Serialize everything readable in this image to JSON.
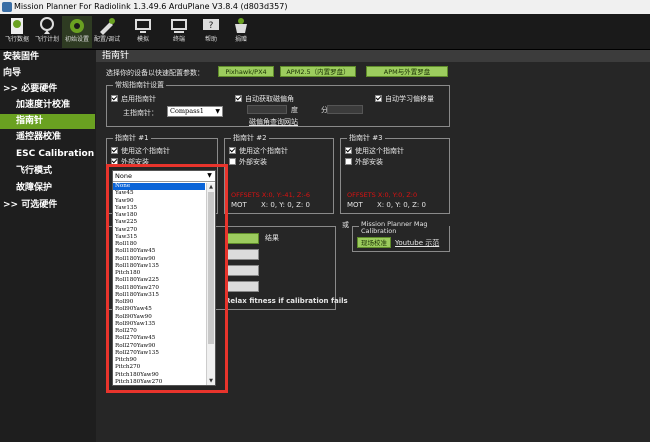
{
  "window": {
    "title": "Mission Planner For Radiolink 1.3.49.6 ArduPlane V3.8.4 (d803d357)"
  },
  "toolbar": {
    "buttons": [
      {
        "label": "飞行数据",
        "icon": "flight-data-icon"
      },
      {
        "label": "飞行计划",
        "icon": "flight-plan-icon"
      },
      {
        "label": "初始设置",
        "icon": "initial-setup-icon"
      },
      {
        "label": "配置/调试",
        "icon": "config-tuning-icon"
      },
      {
        "label": "模拟",
        "icon": "simulation-icon"
      },
      {
        "label": "终端",
        "icon": "terminal-icon"
      },
      {
        "label": "帮助",
        "icon": "help-icon"
      },
      {
        "label": "捐赠",
        "icon": "donate-icon"
      }
    ]
  },
  "sidebar": {
    "items": [
      {
        "label": "安装固件"
      },
      {
        "label": "向导"
      },
      {
        "label": ">> 必要硬件"
      },
      {
        "label": "加速度计校准"
      },
      {
        "label": "指南针"
      },
      {
        "label": "遥控器校准"
      },
      {
        "label": "ESC Calibration"
      },
      {
        "label": "飞行模式"
      },
      {
        "label": "故障保护"
      },
      {
        "label": ">> 可选硬件"
      }
    ],
    "active_index": 4
  },
  "main": {
    "header": "指南针",
    "preset_label": "选择你的设备以快速配置参数：",
    "preset_buttons": [
      "Pixhawk/PX4",
      "APM2.5（内置罗盘）",
      "APM与外置罗盘"
    ],
    "general": {
      "title": "常规指南针设置",
      "enable_compass": "启用指南针",
      "primary_compass_label": "主指南针：",
      "primary_compass_value": "Compass1",
      "auto_declination": "自动获取磁偏角",
      "degree_label": "度",
      "minute_label": "分",
      "auto_learn": "自动学习偏移量",
      "declination_link": "磁偏角查询网站"
    },
    "compass1": {
      "title": "指南针 #1",
      "use": "使用这个指南针",
      "external": "外部安装"
    },
    "compass2": {
      "title": "指南针 #2",
      "use": "使用这个指南针",
      "external": "外部安装",
      "offsets": "OFFSETS X:0, Y:-41, Z:-6",
      "mot": "MOT",
      "mot_values": "X: 0,  Y: 0,  Z: 0"
    },
    "compass3": {
      "title": "指南针 #3",
      "use": "使用这个指南针",
      "external": "外部安装",
      "offsets": "OFFSETS X:0, Y:0, Z:0",
      "mot": "MOT",
      "mot_values": "X: 0,  Y: 0,  Z: 0"
    },
    "onboard": {
      "result_label": "结果",
      "relax": "Relax fitness if calibration fails"
    },
    "or_label": "或",
    "mag": {
      "title": "Mission Planner Mag Calibration",
      "live_button": "现场校准",
      "youtube_link": "Youtube 示范"
    }
  },
  "orientation_dropdown": {
    "selected": "None",
    "options": [
      "None",
      "Yaw45",
      "Yaw90",
      "Yaw135",
      "Yaw180",
      "Yaw225",
      "Yaw270",
      "Yaw315",
      "Roll180",
      "Roll180Yaw45",
      "Roll180Yaw90",
      "Roll180Yaw135",
      "Pitch180",
      "Roll180Yaw225",
      "Roll180Yaw270",
      "Roll180Yaw315",
      "Roll90",
      "Roll90Yaw45",
      "Roll90Yaw90",
      "Roll90Yaw135",
      "Roll270",
      "Roll270Yaw45",
      "Roll270Yaw90",
      "Roll270Yaw135",
      "Pitch90",
      "Pitch270",
      "Pitch180Yaw90",
      "Pitch180Yaw270",
      "Roll90Pitch90",
      "Roll180Pitch90"
    ]
  },
  "colors": {
    "accent_green": "#6aa121",
    "button_green": "#9ccc5e",
    "highlight_red": "#e8342c",
    "offset_red": "#d11111"
  }
}
